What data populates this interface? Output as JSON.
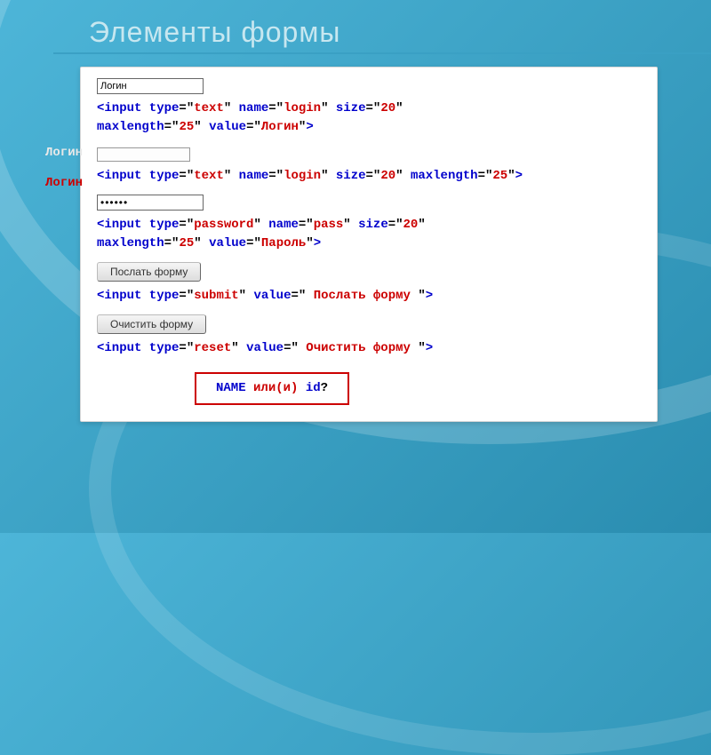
{
  "title": "Элементы формы",
  "example1": {
    "input_value": "Логин",
    "code_pre": "<input type",
    "type_val": "text",
    "name_attr": " name",
    "name_val": "login",
    "size_attr": " size",
    "size_val": "20",
    "max_attr": "maxlength",
    "max_val": "25",
    "value_attr": " value",
    "value_val": "Логин",
    "close": ">"
  },
  "example2": {
    "ghost_label": "Логин",
    "red_label": "Логин",
    "code_pre": "<input type",
    "type_val": "text",
    "name_attr": " name",
    "name_val": "login",
    "size_attr": " size",
    "size_val": "20",
    "max_attr": " maxlength",
    "max_val": "25",
    "close": ">"
  },
  "example3": {
    "pass_display": "••••••",
    "code_pre": "<input type",
    "type_val": "password",
    "name_attr": " name",
    "name_val": "pass",
    "size_attr": " size",
    "size_val": "20",
    "max_attr": "maxlength",
    "max_val": "25",
    "value_attr": " value",
    "value_val": "Пароль",
    "close": ">"
  },
  "example4": {
    "button_label": "Послать форму",
    "code_pre": "<input type",
    "type_val": "submit",
    "value_attr": " value",
    "value_val": " Послать форму ",
    "close": ">"
  },
  "example5": {
    "button_label": "Очистить форму",
    "code_pre": "<input type",
    "type_val": "reset",
    "value_attr": " value",
    "value_val": " Очистить форму ",
    "close": ">"
  },
  "footer_box": {
    "name": "NAME",
    "or": " или(и) ",
    "id": "id",
    "qmark": "?"
  },
  "eq": "="
}
